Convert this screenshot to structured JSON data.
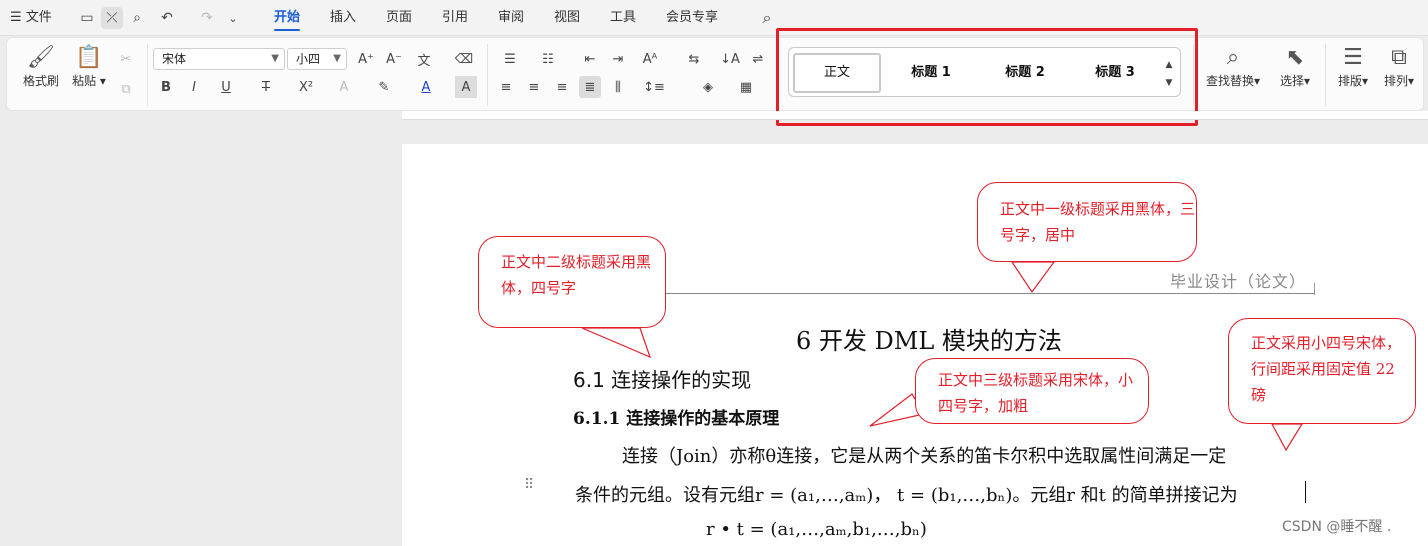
{
  "menu": {
    "file": "文件",
    "tabs": [
      "开始",
      "插入",
      "页面",
      "引用",
      "审阅",
      "视图",
      "工具",
      "会员专享"
    ],
    "active_tab": "开始"
  },
  "ribbon": {
    "format_painter": "格式刷",
    "paste": "粘贴",
    "font_name": "宋体",
    "font_size": "小四",
    "find_replace": "查找替换",
    "select": "选择",
    "layout": "排版",
    "arrange": "排列"
  },
  "styles": {
    "normal": "正文",
    "heading1": "标题 1",
    "heading2": "标题 2",
    "heading3": "标题 3"
  },
  "document": {
    "header": "毕业设计（论文）",
    "h1": "6  开发 DML 模块的方法",
    "h2": "6.1  连接操作的实现",
    "h3": "6.1.1  连接操作的基本原理",
    "p1": "连接（Join）亦称θ连接，它是从两个关系的笛卡尔积中选取属性间满足一定",
    "p2": "条件的元组。设有元组r = (a₁,…,aₘ)， t = (b₁,…,bₙ)。元组r 和t 的简单拼接记为",
    "p3": "r • t = (a₁,…,aₘ,b₁,…,bₙ)"
  },
  "callouts": {
    "c1": "正文中一级标题采用黑体，三号字，居中",
    "c2": "正文中二级标题采用黑体，四号字",
    "c3": "正文中三级标题采用宋体，小四号字，加粗",
    "c4": "正文采用小四号宋体，行间距采用固定值 22 磅"
  },
  "watermark": "CSDN @睡不醒 .",
  "colors": {
    "accent": "#1a5fd6",
    "annotation": "#e3202a"
  }
}
